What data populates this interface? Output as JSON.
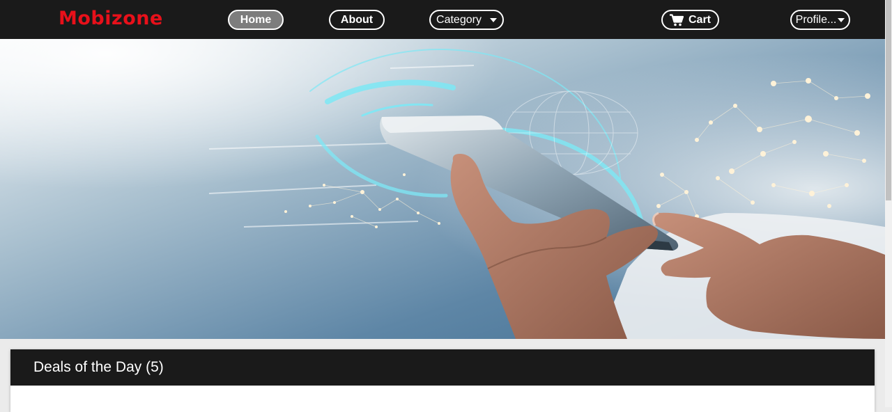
{
  "brand": {
    "name": "Mobizone",
    "color": "#e8101a"
  },
  "nav": {
    "home": "Home",
    "about": "About",
    "category": "Category",
    "cart": "Cart",
    "profile": "Profile...",
    "active": "home"
  },
  "icons": {
    "cart": "shopping-cart-icon",
    "dropdown": "caret-down-icon"
  },
  "hero": {
    "image": "hand-holding-smartphone-with-network-graphics"
  },
  "deals": {
    "title": "Deals of the Day (5)"
  },
  "colors": {
    "navbar_bg": "#1a1a1a",
    "active_pill_bg": "#7d7d7d",
    "page_bg": "#ebebeb"
  }
}
